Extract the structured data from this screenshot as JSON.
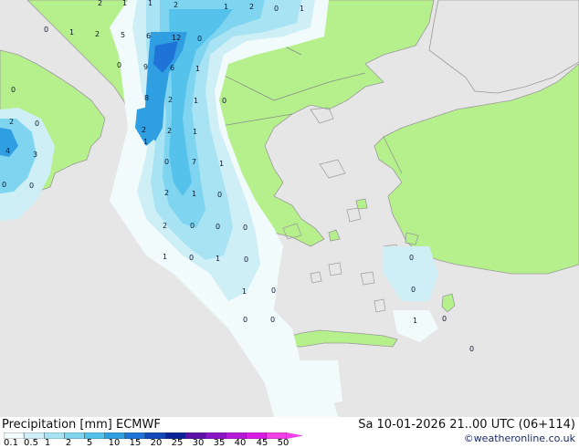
{
  "header": {
    "left_title": "Precipitation [mm]  ECMWF",
    "right_title": "Sa 10-01-2026 21..00 UTC (06+114)",
    "credit": "©weatheronline.co.uk"
  },
  "legend": {
    "labels": [
      "0.1",
      "0.5",
      "1",
      "2",
      "5",
      "10",
      "15",
      "20",
      "25",
      "30",
      "35",
      "40",
      "45",
      "50"
    ],
    "colors": [
      "#f2fbfb",
      "#cfeff7",
      "#a8e3f3",
      "#7fd4ef",
      "#55c2ec",
      "#2f9fe2",
      "#1f73d6",
      "#1447b8",
      "#0b2396",
      "#5b0fa6",
      "#8a16c6",
      "#b41ad8",
      "#d81ee0",
      "#f040e8"
    ]
  },
  "colors": {
    "land": "#b6f08c",
    "sea_no_data": "#e6e6e6",
    "coast": "#9a9a9a",
    "border": "#8a8a8a"
  },
  "map_labels": [
    "2",
    "1",
    "1",
    "2",
    "1",
    "2",
    "0",
    "1",
    "0",
    "1",
    "2",
    "5",
    "6",
    "12",
    "0",
    "0",
    "9",
    "6",
    "1",
    "0",
    "8",
    "2",
    "1",
    "0",
    "2",
    "0",
    "2",
    "2",
    "1",
    "4",
    "3",
    "1",
    "0",
    "7",
    "1",
    "0",
    "0",
    "2",
    "1",
    "0",
    "2",
    "0",
    "0",
    "0",
    "1",
    "0",
    "1",
    "0",
    "0",
    "0",
    "1",
    "0",
    "0",
    "0",
    "1",
    "0",
    "0"
  ]
}
